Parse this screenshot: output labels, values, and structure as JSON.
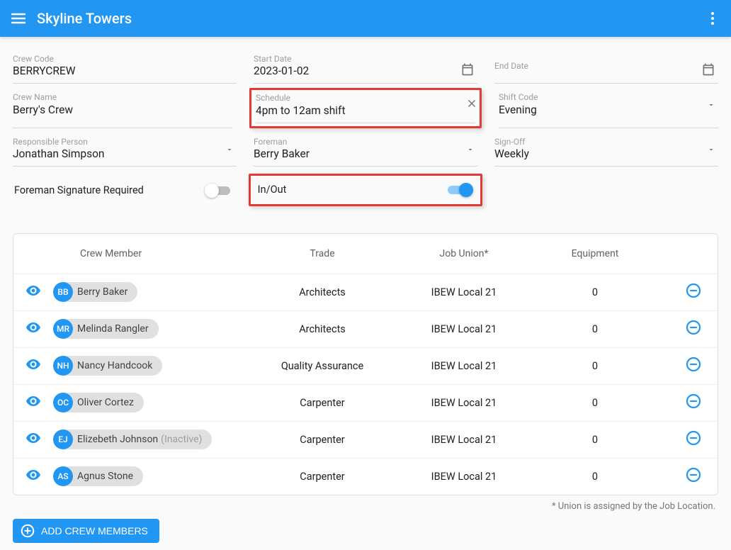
{
  "header": {
    "title": "Skyline Towers"
  },
  "form": {
    "crew_code": {
      "label": "Crew Code",
      "value": "BERRYCREW"
    },
    "start_date": {
      "label": "Start Date",
      "value": "2023-01-02"
    },
    "end_date": {
      "label": "End Date",
      "value": ""
    },
    "crew_name": {
      "label": "Crew Name",
      "value": "Berry's Crew"
    },
    "schedule": {
      "label": "Schedule",
      "value": "4pm to 12am shift"
    },
    "shift_code": {
      "label": "Shift Code",
      "value": "Evening"
    },
    "responsible": {
      "label": "Responsible Person",
      "value": "Jonathan Simpson"
    },
    "foreman": {
      "label": "Foreman",
      "value": "Berry Baker"
    },
    "signoff": {
      "label": "Sign-Off",
      "value": "Weekly"
    },
    "sig_required": {
      "label": "Foreman Signature Required"
    },
    "inout": {
      "label": "In/Out"
    }
  },
  "table": {
    "headers": {
      "member": "Crew Member",
      "trade": "Trade",
      "union": "Job Union*",
      "equipment": "Equipment"
    },
    "rows": [
      {
        "initials": "BB",
        "name": "Berry Baker",
        "inactive": "",
        "trade": "Architects",
        "union": "IBEW Local 21",
        "equipment": "0"
      },
      {
        "initials": "MR",
        "name": "Melinda Rangler",
        "inactive": "",
        "trade": "Architects",
        "union": "IBEW Local 21",
        "equipment": "0"
      },
      {
        "initials": "NH",
        "name": "Nancy Handcook",
        "inactive": "",
        "trade": "Quality Assurance",
        "union": "IBEW Local 21",
        "equipment": "0"
      },
      {
        "initials": "OC",
        "name": "Oliver Cortez",
        "inactive": "",
        "trade": "Carpenter",
        "union": "IBEW Local 21",
        "equipment": "0"
      },
      {
        "initials": "EJ",
        "name": "Elizebeth Johnson",
        "inactive": "(Inactive)",
        "trade": "Carpenter",
        "union": "IBEW Local 21",
        "equipment": "0"
      },
      {
        "initials": "AS",
        "name": "Agnus Stone",
        "inactive": "",
        "trade": "Carpenter",
        "union": "IBEW Local 21",
        "equipment": "0"
      }
    ]
  },
  "footnote": "* Union is assigned by the Job Location.",
  "buttons": {
    "add_members": "ADD CREW MEMBERS"
  }
}
